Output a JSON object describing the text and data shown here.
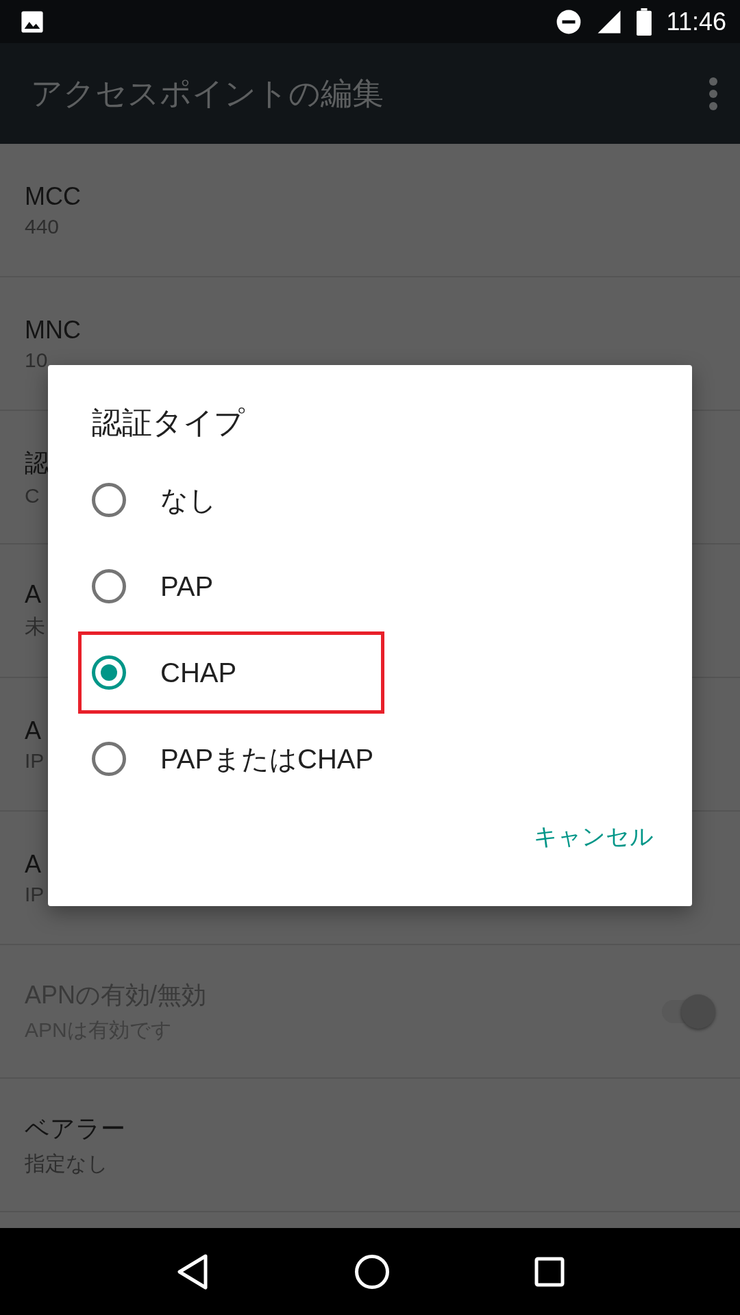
{
  "status_bar": {
    "time": "11:46"
  },
  "app_bar": {
    "title": "アクセスポイントの編集"
  },
  "settings": [
    {
      "kind": "item",
      "title": "MCC",
      "summary": "440"
    },
    {
      "kind": "item",
      "title": "MNC",
      "summary": "10"
    },
    {
      "kind": "item",
      "title": "認",
      "summary": "C"
    },
    {
      "kind": "item",
      "title": "A",
      "summary": "未"
    },
    {
      "kind": "item",
      "title": "A",
      "summary": "IP"
    },
    {
      "kind": "item",
      "title": "A",
      "summary": "IP"
    },
    {
      "kind": "toggle",
      "title": "APNの有効/無効",
      "summary": "APNは有効です",
      "on": true,
      "disabled": true
    },
    {
      "kind": "item",
      "title": "ベアラー",
      "summary": "指定なし"
    }
  ],
  "dialog": {
    "title": "認証タイプ",
    "options": [
      {
        "label": "なし",
        "selected": false,
        "highlighted": false
      },
      {
        "label": "PAP",
        "selected": false,
        "highlighted": false
      },
      {
        "label": "CHAP",
        "selected": true,
        "highlighted": true
      },
      {
        "label": "PAPまたはCHAP",
        "selected": false,
        "highlighted": false
      }
    ],
    "button": "キャンセル"
  }
}
